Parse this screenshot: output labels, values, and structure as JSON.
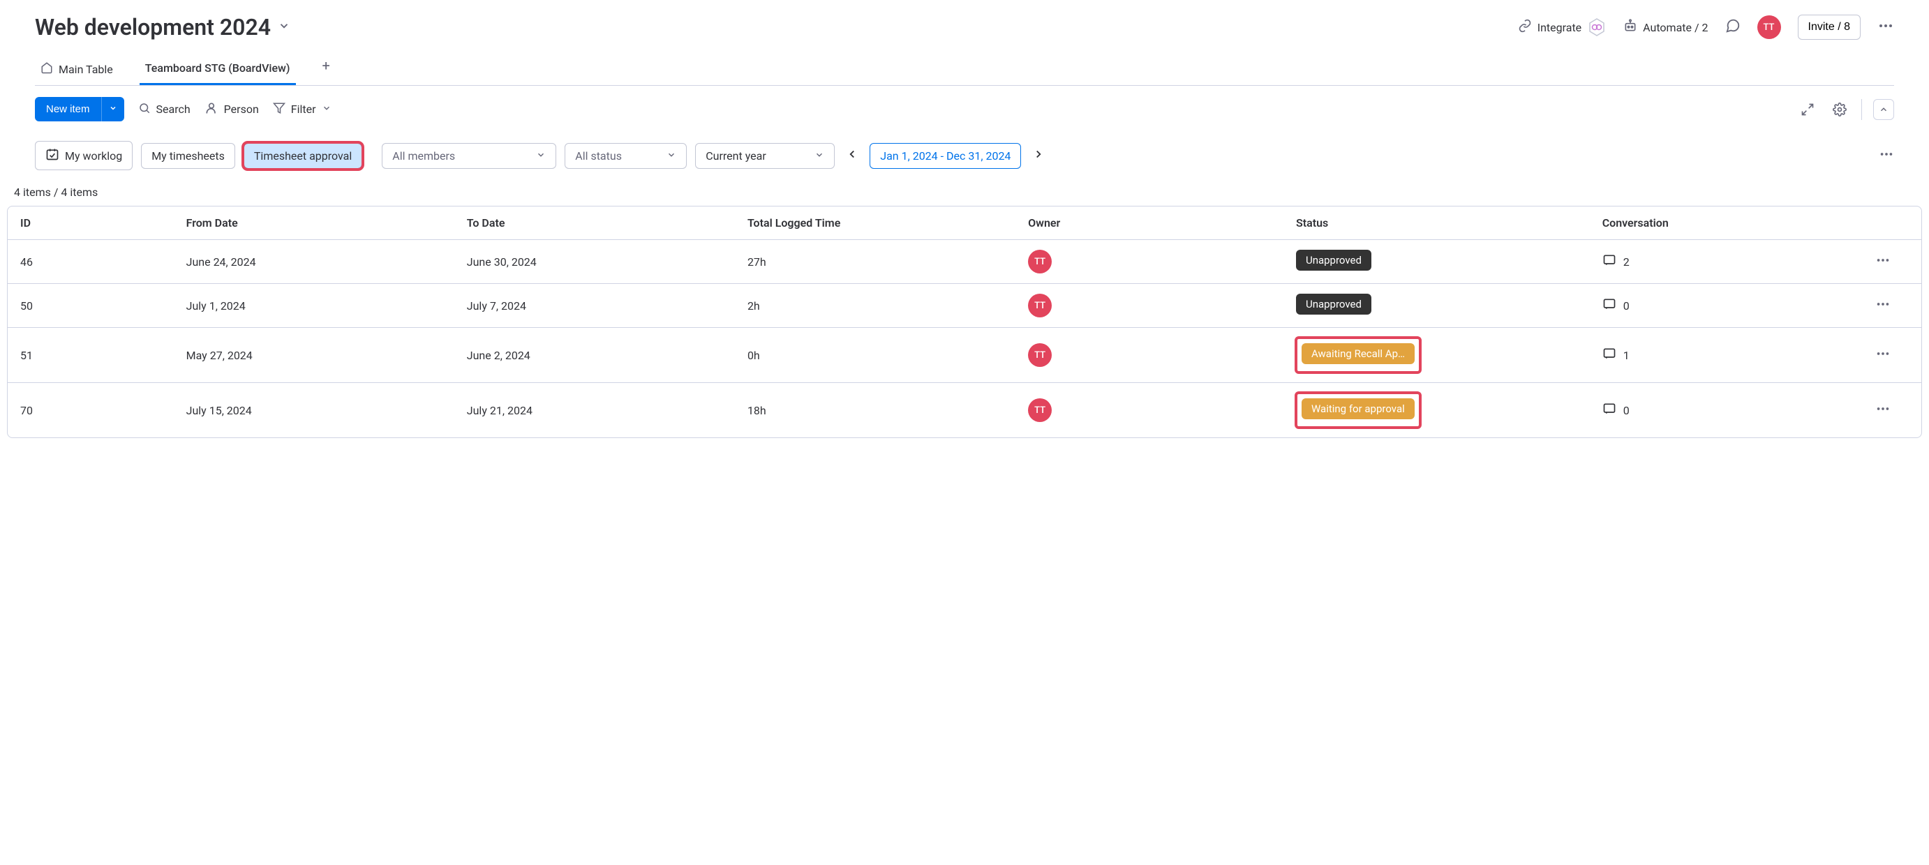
{
  "header": {
    "title": "Web development 2024",
    "integrate": "Integrate",
    "automate": "Automate / 2",
    "avatar_initials": "TT",
    "invite": "Invite / 8"
  },
  "tabs": {
    "main_table": "Main Table",
    "teamboard": "Teamboard STG (BoardView)"
  },
  "toolbar": {
    "new_item": "New item",
    "search": "Search",
    "person": "Person",
    "filter": "Filter"
  },
  "filters": {
    "my_worklog": "My worklog",
    "my_timesheets": "My timesheets",
    "timesheet_approval": "Timesheet approval",
    "members": "All members",
    "status": "All status",
    "year": "Current year",
    "date_range": "Jan 1, 2024 - Dec 31, 2024"
  },
  "count": "4 items / 4 items",
  "table": {
    "headers": {
      "id": "ID",
      "from": "From Date",
      "to": "To Date",
      "total": "Total Logged Time",
      "owner": "Owner",
      "status": "Status",
      "conversation": "Conversation"
    },
    "rows": [
      {
        "id": "46",
        "from": "June 24, 2024",
        "to": "June 30, 2024",
        "total": "27h",
        "owner": "TT",
        "status": "Unapproved",
        "status_type": "dark",
        "conv": "2",
        "highlight": false
      },
      {
        "id": "50",
        "from": "July 1, 2024",
        "to": "July 7, 2024",
        "total": "2h",
        "owner": "TT",
        "status": "Unapproved",
        "status_type": "dark",
        "conv": "0",
        "highlight": false
      },
      {
        "id": "51",
        "from": "May 27, 2024",
        "to": "June 2, 2024",
        "total": "0h",
        "owner": "TT",
        "status": "Awaiting Recall Ap…",
        "status_type": "orange",
        "conv": "1",
        "highlight": true
      },
      {
        "id": "70",
        "from": "July 15, 2024",
        "to": "July 21, 2024",
        "total": "18h",
        "owner": "TT",
        "status": "Waiting for approval",
        "status_type": "orange",
        "conv": "0",
        "highlight": true
      }
    ]
  }
}
